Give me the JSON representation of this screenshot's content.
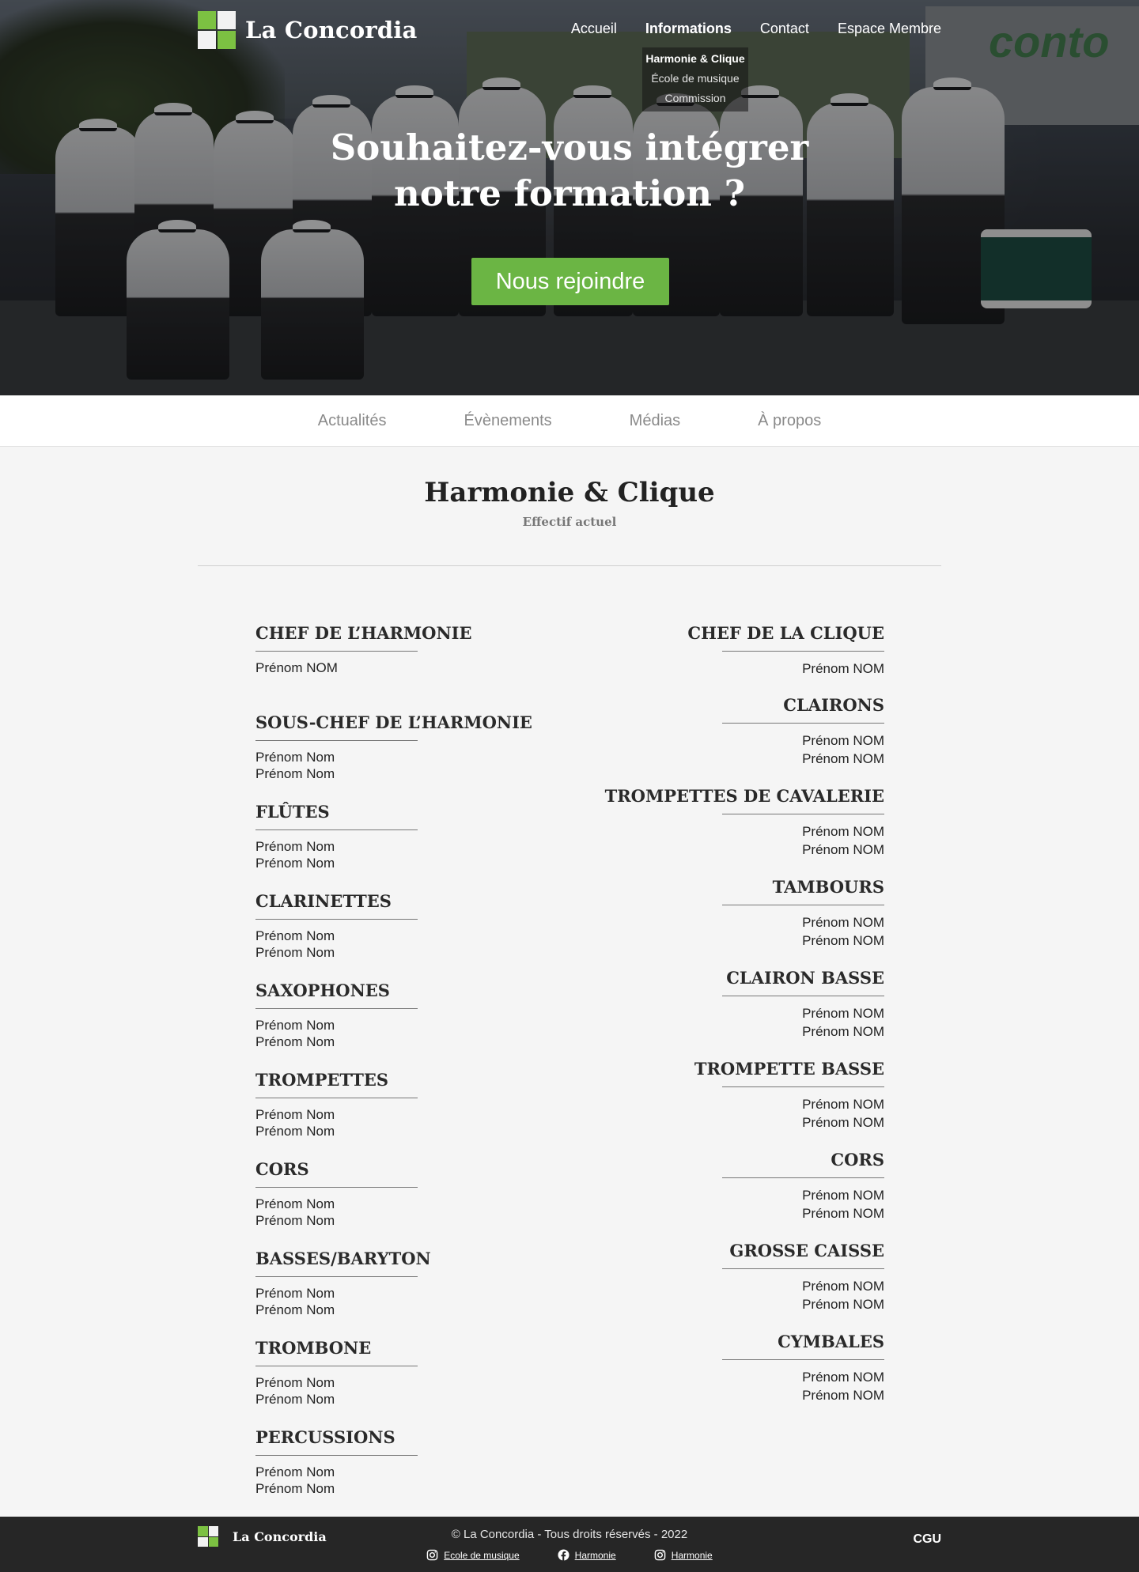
{
  "brand": {
    "name": "La Concordia"
  },
  "nav": {
    "items": [
      {
        "label": "Accueil"
      },
      {
        "label": "Informations"
      },
      {
        "label": "Contact"
      },
      {
        "label": "Espace Membre"
      }
    ],
    "dropdown": [
      "Harmonie & Clique",
      "École de musique",
      "Commission"
    ]
  },
  "hero": {
    "title_line1": "Souhaitez-vous intégrer",
    "title_line2": "notre formation ?",
    "cta": "Nous rejoindre",
    "background_sign": "conto"
  },
  "subnav": [
    "Actualités",
    "Évènements",
    "Médias",
    "À propos"
  ],
  "section": {
    "title": "Harmonie & Clique",
    "subtitle": "Effectif actuel"
  },
  "harmonie": [
    {
      "title": "CHEF DE L’HARMONIE",
      "members": [
        "Prénom NOM"
      ]
    },
    {
      "title": "SOUS-CHEF DE L’HARMONIE",
      "members": [
        "Prénom Nom",
        "Prénom Nom"
      ]
    },
    {
      "title": "FLÛTES",
      "members": [
        "Prénom Nom",
        "Prénom Nom"
      ]
    },
    {
      "title": "CLARINETTES",
      "members": [
        "Prénom Nom",
        "Prénom Nom"
      ]
    },
    {
      "title": "SAXOPHONES",
      "members": [
        "Prénom Nom",
        "Prénom Nom"
      ]
    },
    {
      "title": "TROMPETTES",
      "members": [
        "Prénom Nom",
        "Prénom Nom"
      ]
    },
    {
      "title": "CORS",
      "members": [
        "Prénom Nom",
        "Prénom Nom"
      ]
    },
    {
      "title": "BASSES/BARYTON",
      "members": [
        "Prénom Nom",
        "Prénom Nom"
      ]
    },
    {
      "title": "TROMBONE",
      "members": [
        "Prénom Nom",
        "Prénom Nom"
      ]
    },
    {
      "title": "PERCUSSIONS",
      "members": [
        "Prénom Nom",
        "Prénom Nom"
      ]
    }
  ],
  "clique": [
    {
      "title": "CHEF DE LA CLIQUE",
      "members": [
        "Prénom NOM"
      ]
    },
    {
      "title": "CLAIRONS",
      "members": [
        "Prénom NOM",
        "Prénom NOM"
      ]
    },
    {
      "title": "TROMPETTES DE CAVALERIE",
      "members": [
        "Prénom NOM",
        "Prénom NOM"
      ]
    },
    {
      "title": "TAMBOURS",
      "members": [
        "Prénom NOM",
        "Prénom NOM"
      ]
    },
    {
      "title": "CLAIRON BASSE",
      "members": [
        "Prénom NOM",
        "Prénom NOM"
      ]
    },
    {
      "title": "TROMPETTE BASSE",
      "members": [
        "Prénom NOM",
        "Prénom NOM"
      ]
    },
    {
      "title": "CORS",
      "members": [
        "Prénom NOM",
        "Prénom NOM"
      ]
    },
    {
      "title": "GROSSE CAISSE",
      "members": [
        "Prénom NOM",
        "Prénom NOM"
      ]
    },
    {
      "title": "CYMBALES",
      "members": [
        "Prénom NOM",
        "Prénom NOM"
      ]
    }
  ],
  "footer": {
    "brand": "La Concordia",
    "copyright": "© La Concordia - Tous droits réservés - 2022",
    "cgu": "CGU",
    "links": [
      {
        "icon": "instagram-icon",
        "label": "Ecole de musique"
      },
      {
        "icon": "facebook-icon",
        "label": "Harmonie"
      },
      {
        "icon": "instagram-icon",
        "label": "Harmonie"
      }
    ]
  },
  "colors": {
    "accent": "#6bb544",
    "footer_bg": "#262626",
    "page_bg": "#f5f5f5"
  }
}
